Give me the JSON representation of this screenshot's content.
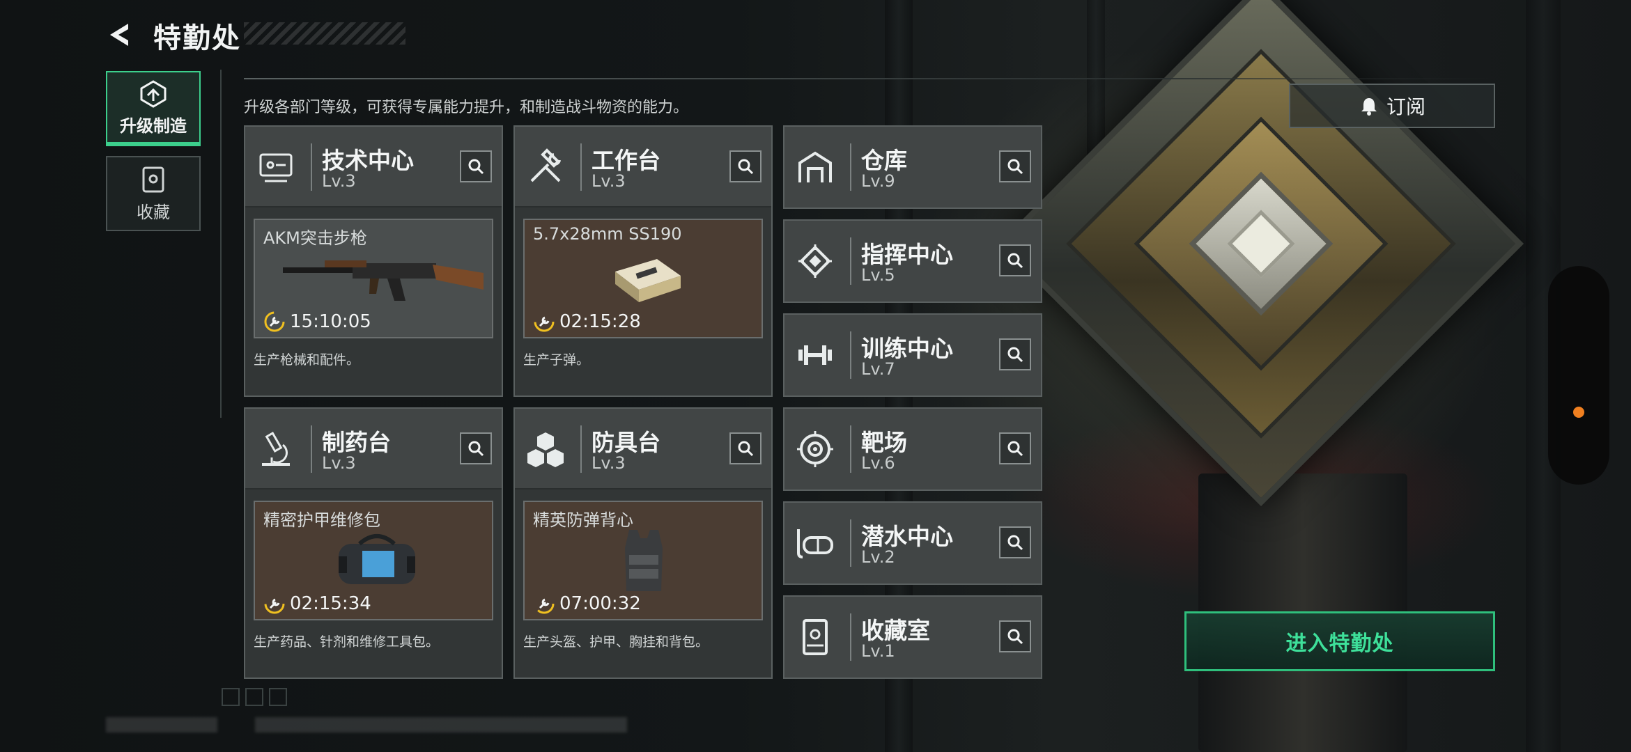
{
  "header": {
    "title": "特勤处",
    "back_icon": "back-arrow-icon"
  },
  "nav": {
    "items": [
      {
        "label": "升级制造",
        "icon": "upgrade-gear-icon",
        "active": true
      },
      {
        "label": "收藏",
        "icon": "collection-cabinet-icon",
        "active": false
      }
    ]
  },
  "description": "升级各部门等级，可获得专属能力提升，和制造战斗物资的能力。",
  "subscribe": {
    "label": "订阅",
    "icon": "bell-icon"
  },
  "large_panels": [
    {
      "name": "技术中心",
      "level": "Lv.3",
      "icon": "tech-center-icon",
      "product": "AKM突击步枪",
      "timer": "15:10:05",
      "desc": "生产枪械和配件。",
      "bg": "gray"
    },
    {
      "name": "工作台",
      "level": "Lv.3",
      "icon": "hammer-wrench-icon",
      "product": "5.7x28mm SS190",
      "timer": "02:15:28",
      "desc": "生产子弹。",
      "bg": "brown"
    },
    {
      "name": "制药台",
      "level": "Lv.3",
      "icon": "microscope-icon",
      "product": "精密护甲维修包",
      "timer": "02:15:34",
      "desc": "生产药品、针剂和维修工具包。",
      "bg": "brown"
    },
    {
      "name": "防具台",
      "level": "Lv.3",
      "icon": "cubes-icon",
      "product": "精英防弹背心",
      "timer": "07:00:32",
      "desc": "生产头盔、护甲、胸挂和背包。",
      "bg": "brown"
    }
  ],
  "small_panels": [
    {
      "name": "仓库",
      "level": "Lv.9",
      "icon": "warehouse-icon"
    },
    {
      "name": "指挥中心",
      "level": "Lv.5",
      "icon": "command-chip-icon"
    },
    {
      "name": "训练中心",
      "level": "Lv.7",
      "icon": "dumbbell-icon"
    },
    {
      "name": "靶场",
      "level": "Lv.6",
      "icon": "target-icon"
    },
    {
      "name": "潜水中心",
      "level": "Lv.2",
      "icon": "diving-mask-icon"
    },
    {
      "name": "收藏室",
      "level": "Lv.1",
      "icon": "collection-room-icon"
    }
  ],
  "enter_button": {
    "label": "进入特勤处"
  },
  "colors": {
    "accent_green": "#3ccf8c",
    "enter_text": "#3ee09a",
    "timer_ring": "#f0c020",
    "side_dot": "#f08020"
  }
}
